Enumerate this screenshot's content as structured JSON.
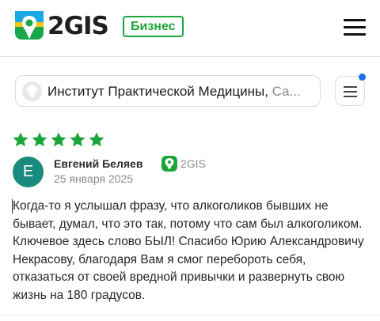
{
  "header": {
    "brand": "2GIS",
    "badge": "Бизнес",
    "logo_icon": "2gis-logo-icon",
    "menu_icon": "hamburger-icon"
  },
  "organization": {
    "name": "Институт Практической Медицины",
    "separator": ", ",
    "city": "Са...",
    "list_icon": "list-icon",
    "has_notification": true
  },
  "review": {
    "rating": 5,
    "max_rating": 5,
    "author_initial": "Е",
    "author": "Евгений Беляев",
    "source": "2GIS",
    "date": "25 января 2025",
    "text": "Когда-то я услышал фразу, что алкоголиков бывших не бывает, думал, что это так, потому что сам был алкоголиком. Ключевое здесь слово БЫЛ! Спасибо Юрию Александровичу Некрасову, благодаря Вам я смог перебороть себя, отказаться от своей вредной привычки и развернуть свою жизнь на 180 градусов."
  },
  "colors": {
    "accent_green": "#1ca53a",
    "star": "#1ca53a",
    "avatar_bg": "#1b8b7f",
    "notification": "#1b6ff3"
  }
}
